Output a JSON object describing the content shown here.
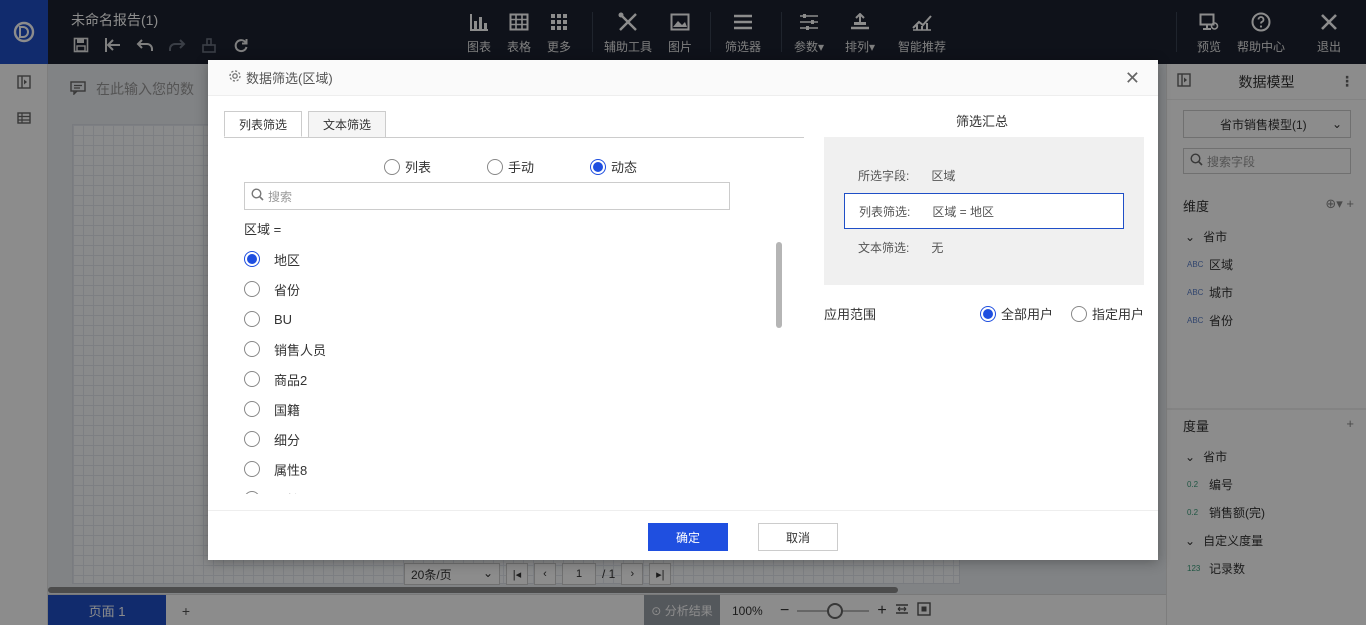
{
  "app": {
    "title": "未命名报告(1)"
  },
  "toolbar": {
    "tools": [
      {
        "name": "chart",
        "label": "图表",
        "icon": "bar-chart-icon"
      },
      {
        "name": "table",
        "label": "表格",
        "icon": "table-icon"
      },
      {
        "name": "more",
        "label": "更多",
        "icon": "grid-icon"
      },
      {
        "name": "aux",
        "label": "辅助工具",
        "icon": "tools-icon"
      },
      {
        "name": "image",
        "label": "图片",
        "icon": "image-icon"
      },
      {
        "name": "filter",
        "label": "筛选器",
        "icon": "filter-list-icon"
      },
      {
        "name": "params",
        "label": "参数",
        "icon": "sliders-icon"
      },
      {
        "name": "arrange",
        "label": "排列",
        "icon": "arrange-icon"
      },
      {
        "name": "smart",
        "label": "智能推荐",
        "icon": "trend-icon"
      }
    ],
    "right_tools": [
      {
        "name": "preview",
        "label": "预览",
        "icon": "preview-icon"
      },
      {
        "name": "help",
        "label": "帮助中心",
        "icon": "help-icon"
      },
      {
        "name": "exit",
        "label": "退出",
        "icon": "close-icon"
      }
    ]
  },
  "canvas": {
    "comment_placeholder": "在此输入您的数",
    "pager": {
      "page_size": "20条/页",
      "page_input": "1",
      "page_total": "/ 1"
    }
  },
  "bottom": {
    "page_tab": "页面 1",
    "add_page": "+",
    "analysis": "分析结果",
    "zoom": "100%"
  },
  "data_model": {
    "title": "数据模型",
    "model_select": "省市销售模型(1)",
    "search_placeholder": "搜索字段",
    "dimensions_label": "维度",
    "dim_group": "省市",
    "dimensions": [
      {
        "tag": "ABC",
        "label": "区域"
      },
      {
        "tag": "ABC",
        "label": "城市"
      },
      {
        "tag": "ABC",
        "label": "省份"
      }
    ],
    "measures_label": "度量",
    "measure_group": "省市",
    "measures": [
      {
        "tag": "0.2",
        "label": "编号"
      },
      {
        "tag": "0.2",
        "label": "销售额(完)"
      }
    ],
    "custom_group": "自定义度量",
    "custom_measures": [
      {
        "tag": "123",
        "label": "记录数"
      }
    ]
  },
  "dialog": {
    "title": "数据筛选(区域)",
    "tabs": [
      "列表筛选",
      "文本筛选"
    ],
    "active_tab": 0,
    "modes": [
      {
        "label": "列表",
        "selected": false
      },
      {
        "label": "手动",
        "selected": false
      },
      {
        "label": "动态",
        "selected": true
      }
    ],
    "search_placeholder": "搜索",
    "condition": "区域 =",
    "fields": [
      {
        "label": "地区",
        "selected": true
      },
      {
        "label": "省份",
        "selected": false
      },
      {
        "label": "BU",
        "selected": false
      },
      {
        "label": "销售人员",
        "selected": false
      },
      {
        "label": "商品2",
        "selected": false
      },
      {
        "label": "国籍",
        "selected": false
      },
      {
        "label": "细分",
        "selected": false
      },
      {
        "label": "属性8",
        "selected": false
      },
      {
        "label": "属性",
        "selected": false
      }
    ],
    "summary": {
      "title": "筛选汇总",
      "selected_field_label": "所选字段:",
      "selected_field_value": "区域",
      "list_filter_label": "列表筛选:",
      "list_filter_value": "区域 = 地区",
      "text_filter_label": "文本筛选:",
      "text_filter_value": "无"
    },
    "scope": {
      "label": "应用范围",
      "options": [
        {
          "label": "全部用户",
          "selected": true
        },
        {
          "label": "指定用户",
          "selected": false
        }
      ]
    },
    "ok_label": "确定",
    "cancel_label": "取消"
  },
  "colors": {
    "topbar": "#1c2230",
    "accent": "#1f4fe0",
    "brand": "#1f4fc7"
  }
}
